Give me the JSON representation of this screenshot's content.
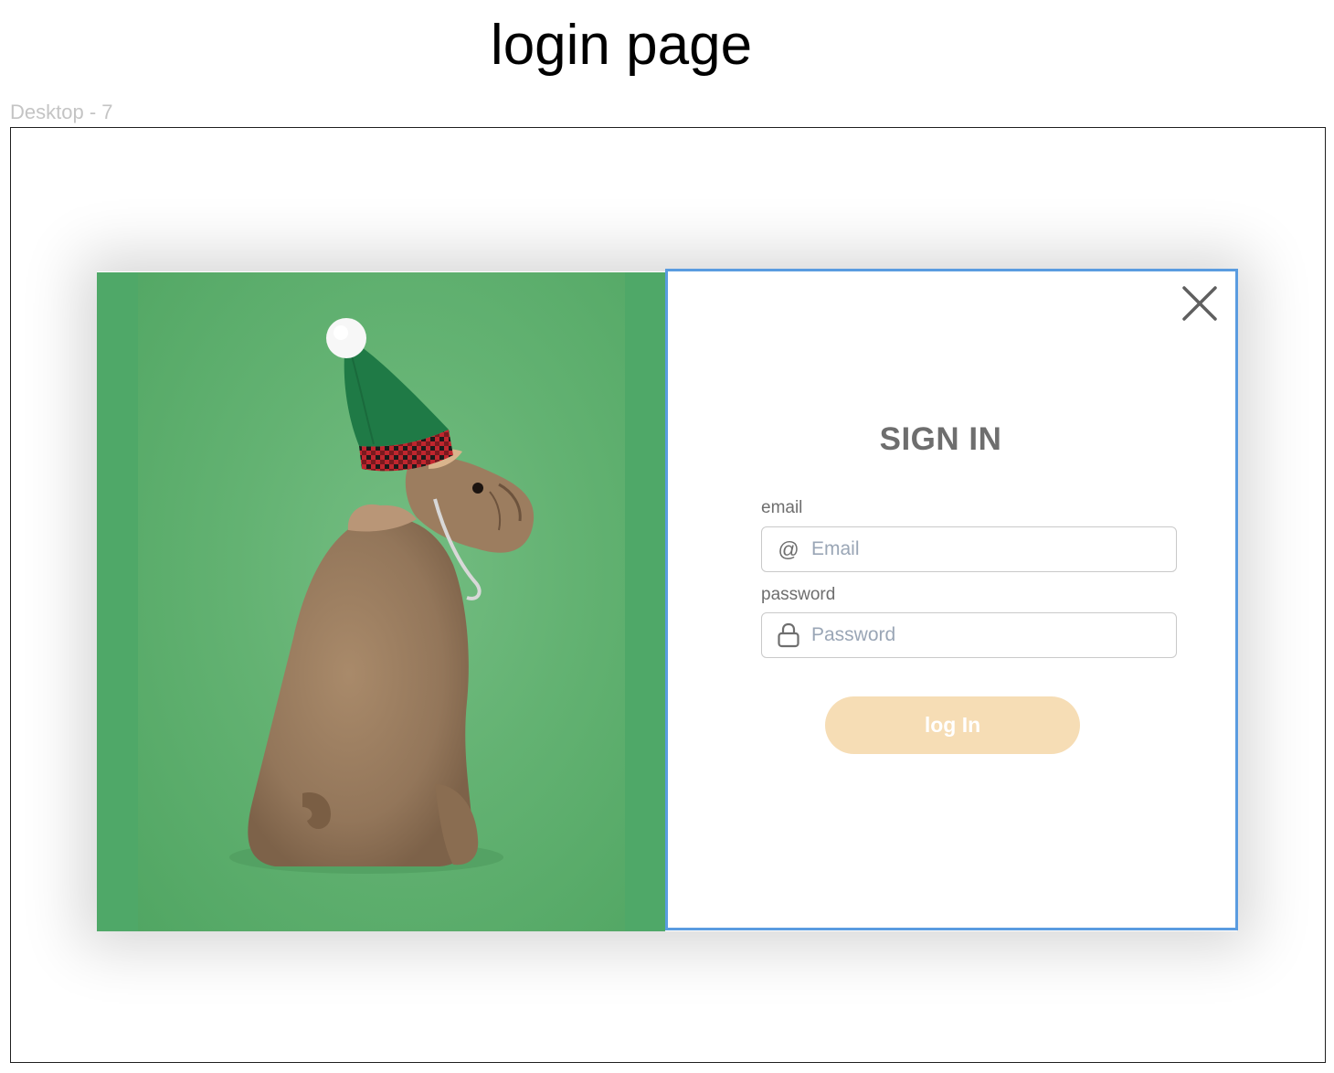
{
  "header": {
    "title": "login page",
    "frame_label": "Desktop - 7"
  },
  "login": {
    "title": "SIGN IN",
    "email_label": "email",
    "email_placeholder": "Email",
    "email_icon": "at-icon",
    "password_label": "password",
    "password_placeholder": "Password",
    "password_icon": "lock-icon",
    "submit_label": "log In",
    "close_icon": "close-icon"
  },
  "colors": {
    "photo_background": "#4fa868",
    "panel_border": "#5a9ce0",
    "button_background": "#f6ddb5",
    "title_text": "#6e6e6e"
  }
}
